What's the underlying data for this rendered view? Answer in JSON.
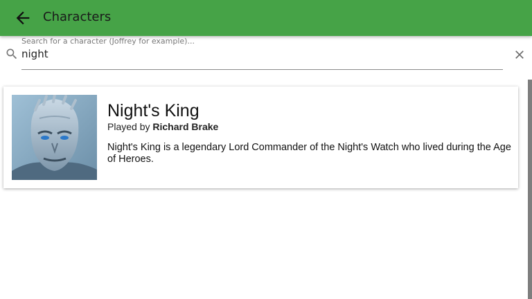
{
  "header": {
    "title": "Characters",
    "background_color": "#46a347",
    "back_icon": "arrow-left-icon"
  },
  "search": {
    "placeholder": "Search for a character (Joffrey for example)...",
    "value": "night",
    "search_icon": "search-icon",
    "clear_icon": "close-icon"
  },
  "results": [
    {
      "name": "Night's King",
      "played_by_prefix": "Played by",
      "actor": "Richard Brake",
      "description": "Night's King is a legendary Lord Commander of the Night's Watch who lived during the Age of Heroes."
    }
  ]
}
